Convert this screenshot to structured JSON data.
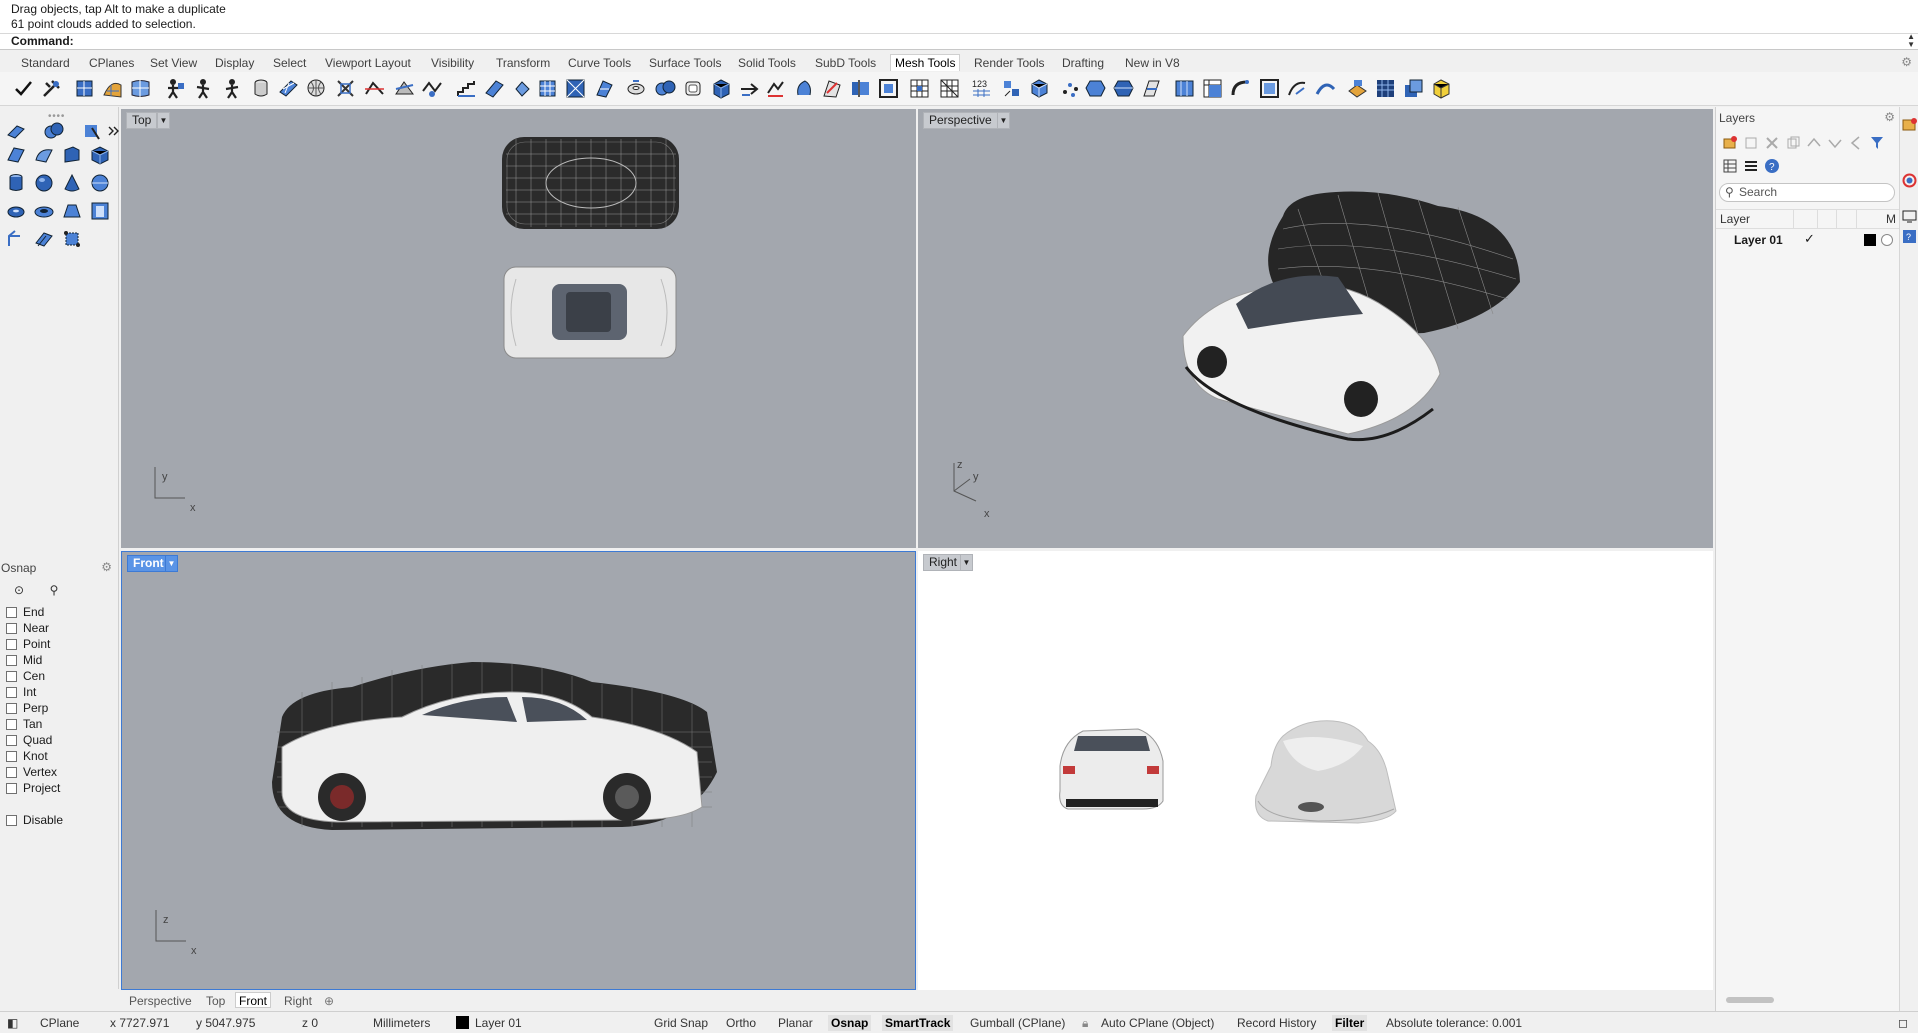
{
  "history": {
    "line1": "Drag objects, tap Alt to make a duplicate",
    "line2": "61 point clouds added to selection.",
    "command_label": "Command:"
  },
  "tabs": [
    "Standard",
    "CPlanes",
    "Set View",
    "Display",
    "Select",
    "Viewport Layout",
    "Visibility",
    "Transform",
    "Curve Tools",
    "Surface Tools",
    "Solid Tools",
    "SubD Tools",
    "Mesh Tools",
    "Render Tools",
    "Drafting",
    "New in V8"
  ],
  "active_tab": "Mesh Tools",
  "viewports": {
    "top": {
      "label": "Top",
      "axis_v": "y",
      "axis_h": "x"
    },
    "perspective": {
      "label": "Perspective",
      "axis_z": "z",
      "axis_v": "y",
      "axis_h": "x"
    },
    "front": {
      "label": "Front",
      "axis_v": "z",
      "axis_h": "x"
    },
    "right": {
      "label": "Right"
    }
  },
  "osnap": {
    "title": "Osnap",
    "items": [
      "End",
      "Near",
      "Point",
      "Mid",
      "Cen",
      "Int",
      "Perp",
      "Tan",
      "Quad",
      "Knot",
      "Vertex",
      "Project"
    ],
    "disable": "Disable"
  },
  "viewport_tabs": [
    "Perspective",
    "Top",
    "Front",
    "Right"
  ],
  "active_viewport_tab": "Front",
  "layers": {
    "title": "Layers",
    "search_placeholder": "Search",
    "col_layer": "Layer",
    "col_m": "M",
    "rows": [
      {
        "name": "Layer 01",
        "current": "✓",
        "color": "#000000"
      }
    ]
  },
  "status": {
    "cplane": "CPlane",
    "x": "x 7727.971",
    "y": "y 5047.975",
    "z": "z 0",
    "units": "Millimeters",
    "layer": "Layer 01",
    "grid_snap": "Grid Snap",
    "ortho": "Ortho",
    "planar": "Planar",
    "osnap": "Osnap",
    "smarttrack": "SmartTrack",
    "gumball": "Gumball (CPlane)",
    "auto_cplane": "Auto CPlane (Object)",
    "record_history": "Record History",
    "filter": "Filter",
    "tolerance": "Absolute tolerance: 0.001"
  },
  "colors": {
    "viewport_bg": "#a3a7ae",
    "active_label": "#5a94e6",
    "car_body": "#f2f2f2",
    "wireframe": "#111111"
  }
}
